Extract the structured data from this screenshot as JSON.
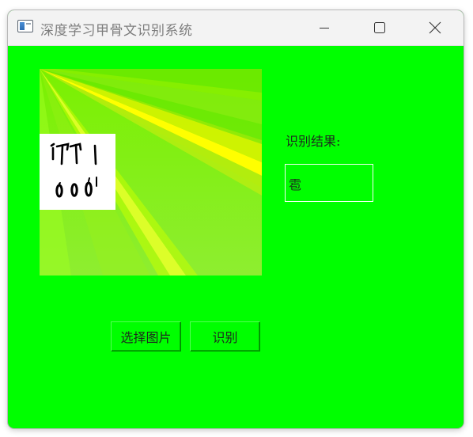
{
  "window": {
    "title": "深度学习甲骨文识别系统",
    "icon": "app-window-icon",
    "controls": {
      "minimize_icon": "minimize-icon",
      "maximize_icon": "maximize-icon",
      "close_icon": "close-icon"
    },
    "background_color": "#00ff00"
  },
  "image_panel": {
    "content": "gradient-placeholder",
    "thumbnail": "oracle-bone-character-image"
  },
  "result": {
    "label": "识别结果:",
    "value": "雹"
  },
  "buttons": {
    "select_image": "选择图片",
    "recognize": "识别"
  }
}
